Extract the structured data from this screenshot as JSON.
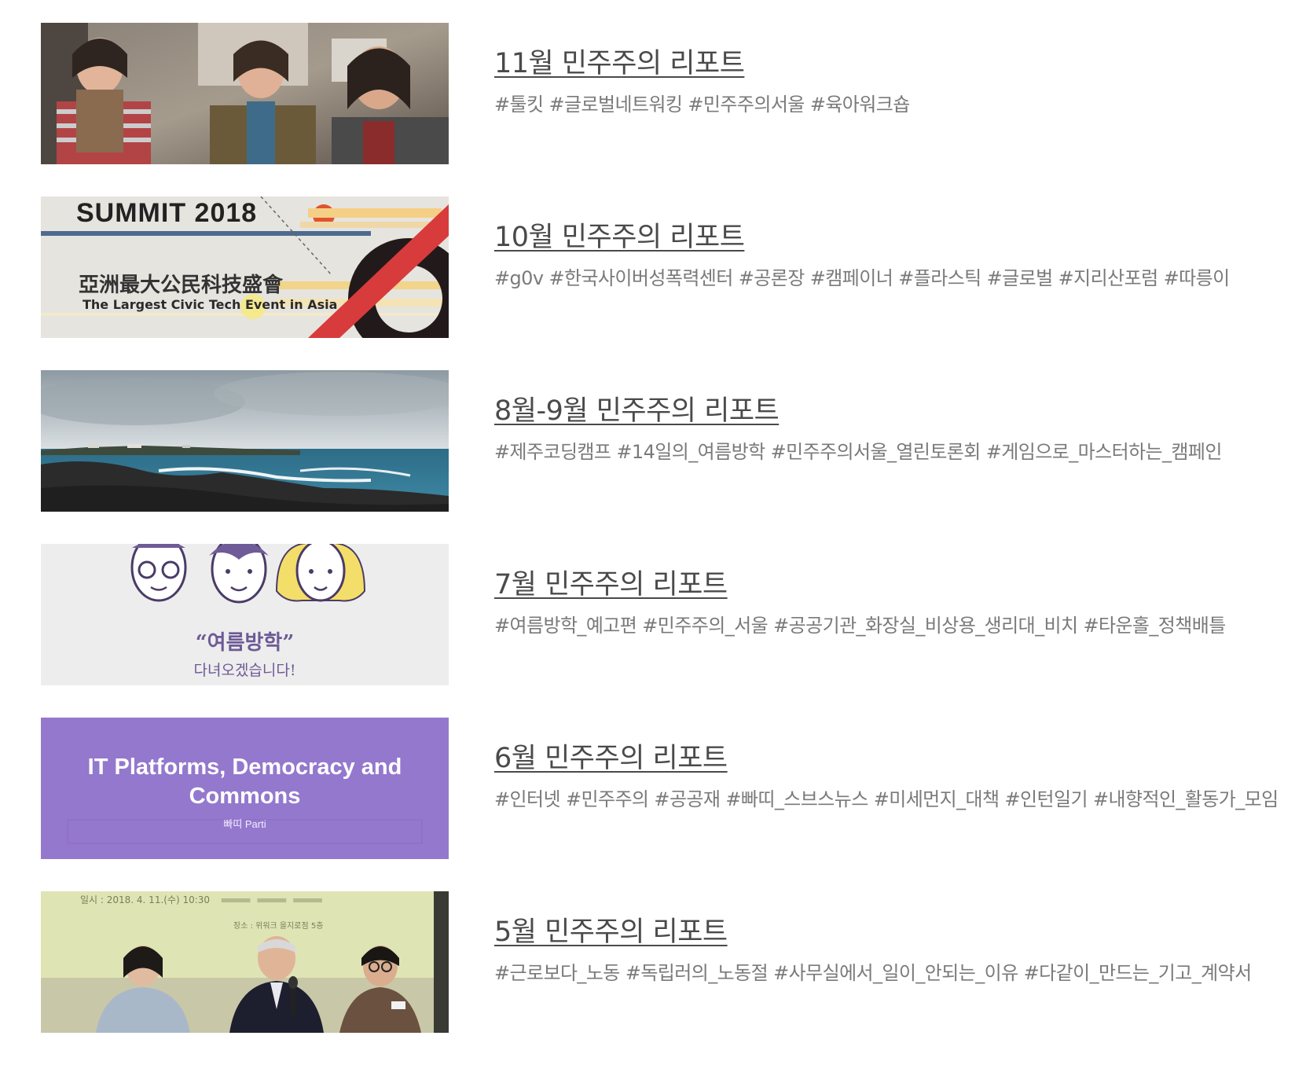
{
  "reports": [
    {
      "title": "11월 민주주의 리포트",
      "tags": "#툴킷 #글로벌네트워킹 #민주주의서울 #육아워크숍",
      "thumbnail": "photo of smiling women at a workshop"
    },
    {
      "title": "10월 민주주의 리포트",
      "tags": "#g0v #한국사이버성폭력센터 #공론장 #캠페이너 #플라스틱 #글로벌 #지리산포럼 #따릉이",
      "thumbnail": "summit banner",
      "thumb_text": {
        "heading": "SUMMIT  2018",
        "cjk": "亞洲最大公民科技盛會",
        "subtitle": "The Largest Civic Tech Event in Asia"
      }
    },
    {
      "title": "8월-9월 민주주의 리포트",
      "tags": "#제주코딩캠프 #14일의_여름방학 #민주주의서울_열린토론회 #게임으로_마스터하는_캠페인",
      "thumbnail": "coastline seascape photo"
    },
    {
      "title": "7월 민주주의 리포트",
      "tags": "#여름방학_예고편 #민주주의_서울 #공공기관_화장실_비상용_생리대_비치 #타운홀_정책배틀",
      "thumbnail": "illustrated faces summer break notice",
      "thumb_text": {
        "quote": "“여름방학”",
        "sub": "다녀오겠습니다!"
      }
    },
    {
      "title": "6월 민주주의 리포트",
      "tags": "#인터넷 #민주주의 #공공재 #빠띠_스브스뉴스 #미세먼지_대책 #인턴일기 #내향적인_활동가_모임",
      "thumbnail": "purple title card",
      "thumb_text": {
        "heading": "IT Platforms, Democracy and Commons",
        "sub": "빠띠 Parti"
      }
    },
    {
      "title": "5월 민주주의 리포트",
      "tags": "#근로보다_노동 #독립러의_노동절 #사무실에서_일이_안되는_이유 #다같이_만드는_기고_계약서",
      "thumbnail": "panel discussion photo",
      "thumb_text": {
        "date": "일시 : 2018. 4. 11.(수) 10:30",
        "place": "장소 : 위워크 을지로점 5층"
      }
    }
  ]
}
